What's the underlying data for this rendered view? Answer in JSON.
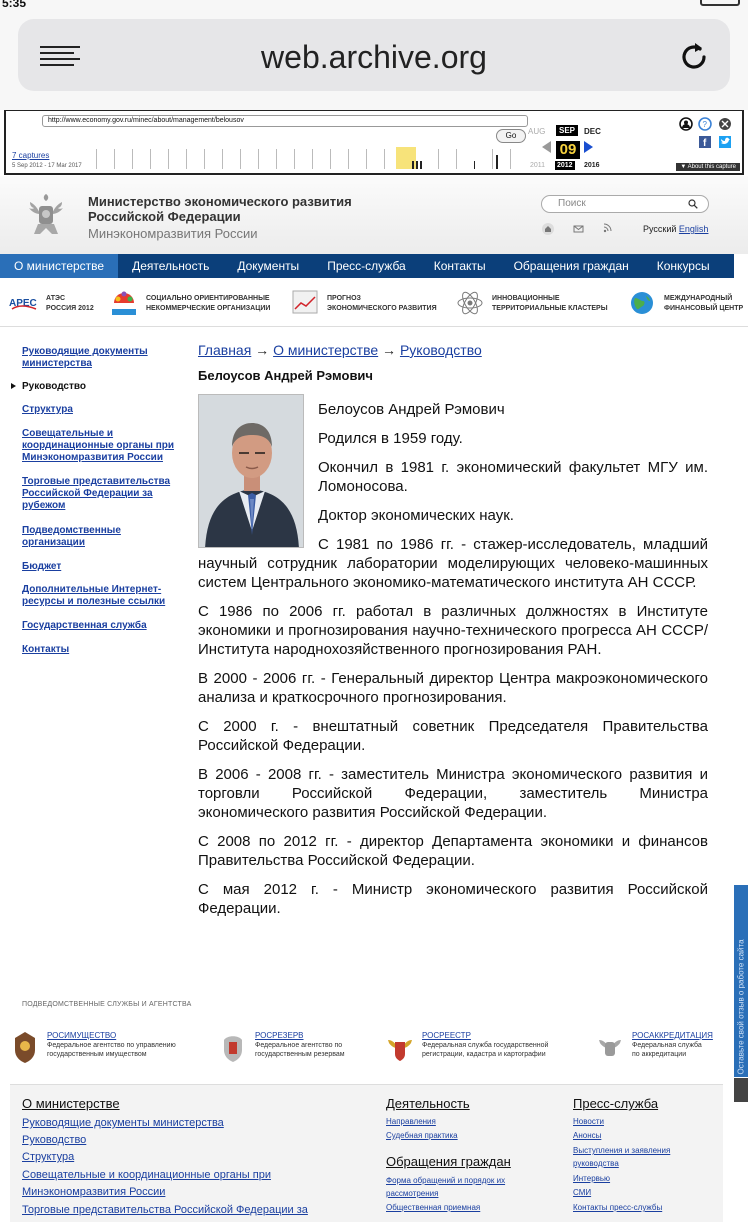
{
  "browser": {
    "time": "5:35",
    "url": "web.archive.org"
  },
  "wayback": {
    "archived_url": "http://www.economy.gov.ru/minec/about/management/belousov",
    "go_label": "Go",
    "captures": "7 captures",
    "captures_range": "5 Sep 2012 - 17 Mar 2017",
    "month_prev": "AUG",
    "month_cur": "SEP",
    "month_next": "DEC",
    "day": "09",
    "year_prev": "2011",
    "year_cur": "2012",
    "year_next": "2016",
    "about": "▼ About this capture"
  },
  "site": {
    "org_line1": "Министерство экономического развития",
    "org_line2": "Российской Федерации",
    "org_line3": "Минэкономразвития России",
    "search_placeholder": "Поиск",
    "lang_ru": "Русский",
    "lang_en": "English"
  },
  "nav": [
    "О министерстве",
    "Деятельность",
    "Документы",
    "Пресс-служба",
    "Контакты",
    "Обращения граждан",
    "Конкурсы"
  ],
  "banners": [
    {
      "line1": "АТЭС",
      "line2": "РОССИЯ 2012"
    },
    {
      "line1": "СОЦИАЛЬНО ОРИЕНТИРОВАННЫЕ",
      "line2": "НЕКОММЕРЧЕСКИЕ ОРГАНИЗАЦИИ"
    },
    {
      "line1": "ПРОГНОЗ",
      "line2": "ЭКОНОМИЧЕСКОГО РАЗВИТИЯ"
    },
    {
      "line1": "ИННОВАЦИОННЫЕ",
      "line2": "ТЕРРИТОРИАЛЬНЫЕ КЛАСТЕРЫ"
    },
    {
      "line1": "МЕЖДУНАРОДНЫЙ",
      "line2": "ФИНАНСОВЫЙ ЦЕНТР"
    }
  ],
  "sidebar": {
    "i0a": "Руководящие документы",
    "i0b": "министерства",
    "i1": "Руководство",
    "i2": "Структура",
    "i3a": "Совещательные и",
    "i3b": "координационные органы при",
    "i3c": "Минэкономразвития России",
    "i4a": "Торговые представительства",
    "i4b": "Российской Федерации за",
    "i4c": "рубежом",
    "i5a": "Подведомственные",
    "i5b": "организации",
    "i6": "Бюджет",
    "i7a": "Дополнительные Интернет-",
    "i7b": "ресурсы и полезные ссылки",
    "i8": "Государственная служба",
    "i9": "Контакты"
  },
  "breadcrumb": {
    "home": "Главная",
    "sep": " → ",
    "about": "О министерстве",
    "management": "Руководство"
  },
  "page_title": "Белоусов Андрей Рэмович",
  "bio": {
    "name": "Белоусов Андрей Рэмович",
    "born": "Родился в 1959 году.",
    "education": "Окончил в 1981 г. экономический факультет МГУ им. Ломоносова.",
    "degree": "Доктор экономических наук.",
    "p1": "С 1981 по 1986 гг. - стажер-исследователь, младший научный сотрудник лаборатории моделирующих человеко-машинных систем Центрального экономико-математического института АН СССР.",
    "p2": "С 1986 по 2006 гг. работал в различных должностях в Институте экономики и прогнозирования научно-технического прогресса АН СССР/Института народнохозяйственного прогнозирования РАН.",
    "p3": "В 2000 - 2006 гг. - Генеральный директор Центра макроэкономического анализа и краткосрочного прогнозирования.",
    "p4": "С 2000 г. - внештатный советник Председателя Правительства Российской Федерации.",
    "p5": "В 2006 - 2008 гг. - заместитель Министра экономического развития и торговли Российской Федерации, заместитель Министра экономического развития Российской Федерации.",
    "p6": "С 2008 по 2012 гг. - директор Департамента экономики и финансов Правительства Российской Федерации.",
    "p7": "С мая 2012 г. - Министр экономического развития Российской Федерации."
  },
  "feedback_tab": "Оставьте свой отзыв о работе сайта",
  "agencies": {
    "title": "ПОДВЕДОМСТВЕННЫЕ СЛУЖБЫ И АГЕНТСТВА",
    "items": [
      {
        "name": "РОСИМУЩЕСТВО",
        "d1": "Федеральное агентство по управлению",
        "d2": "государственным имуществом"
      },
      {
        "name": "РОСРЕЗЕРВ",
        "d1": "Федеральное агентство по",
        "d2": "государственным резервам"
      },
      {
        "name": "РОСРЕЕСТР",
        "d1": "Федеральная служба государственной",
        "d2": "регистрации, кадастра и картографии"
      },
      {
        "name": "РОСАККРЕДИТАЦИЯ",
        "d1": "Федеральная служба",
        "d2": "по аккредитации"
      }
    ]
  },
  "footer": {
    "col1_head": "О министерстве",
    "col1": [
      "Руководящие документы министерства",
      "Руководство",
      "Структура",
      "Совещательные и координационные органы при",
      "Минэкономразвития России",
      "Торговые представительства Российской Федерации за"
    ],
    "col2_head": "Деятельность",
    "col2": [
      "Направления",
      "Судебная практика"
    ],
    "col2b_head": "Обращения граждан",
    "col2b": [
      "Форма обращений и порядок их",
      "рассмотрения",
      "Общественная приемная"
    ],
    "col3_head": "Пресс-служба",
    "col3": [
      "Новости",
      "Анонсы",
      "Выступления и заявления",
      "руководства",
      "Интервью",
      "СМИ",
      "Контакты пресс-службы"
    ]
  },
  "colors": {
    "nav_bg": "#0b3f7a",
    "nav_active": "#2a6fb8",
    "link": "#1a3fa0"
  }
}
